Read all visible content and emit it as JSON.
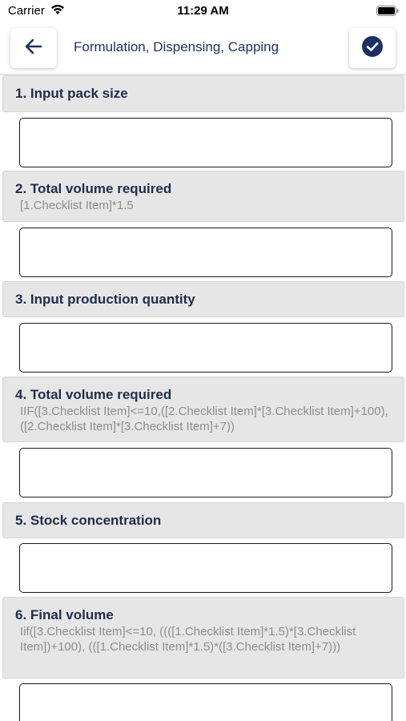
{
  "status_bar": {
    "carrier": "Carrier",
    "time": "11:29 AM"
  },
  "header": {
    "title": "Formulation, Dispensing, Capping",
    "back_icon": "arrow-left-icon",
    "done_icon": "check-circle-icon",
    "accent_color": "#1c2f66"
  },
  "checklist": [
    {
      "title": "1. Input pack size",
      "formula": "",
      "value": ""
    },
    {
      "title": "2. Total volume required",
      "formula": "[1.Checklist Item]*1.5",
      "value": ""
    },
    {
      "title": "3. Input production quantity",
      "formula": "",
      "value": ""
    },
    {
      "title": "4. Total volume required",
      "formula": "IIF([3.Checklist Item]<=10,([2.Checklist Item]*[3.Checklist Item]+100),([2.Checklist Item]*[3.Checklist Item]+7))",
      "value": ""
    },
    {
      "title": "5. Stock concentration",
      "formula": "",
      "value": ""
    },
    {
      "title": "6. Final volume",
      "formula": "Iif([3.Checklist Item]<=10, ((([1.Checklist Item]*1.5)*[3.Checklist Item])+100), (([1.Checklist Item]*1.5)*([3.Checklist Item]+7)))",
      "value": ""
    }
  ]
}
